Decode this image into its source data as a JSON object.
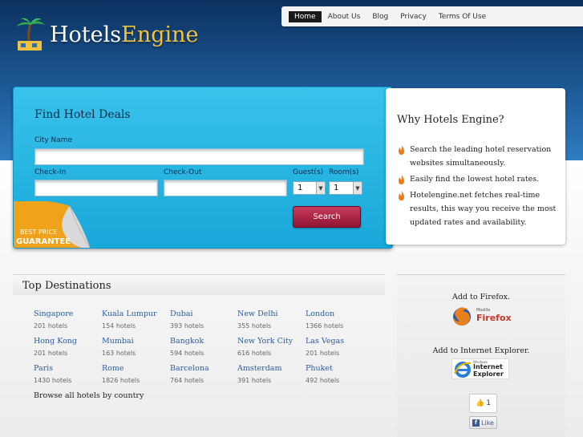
{
  "brand": {
    "hotels": "Hotels",
    "engine": "Engine"
  },
  "nav": [
    {
      "label": "Home",
      "active": true
    },
    {
      "label": "About Us"
    },
    {
      "label": "Blog"
    },
    {
      "label": "Privacy"
    },
    {
      "label": "Terms Of Use"
    }
  ],
  "search": {
    "title": "Find Hotel Deals",
    "city_label": "City Name",
    "city_value": "",
    "checkin_label": "Check-In",
    "checkin_value": "",
    "checkout_label": "Check-Out",
    "checkout_value": "",
    "guests_label": "Guest(s)",
    "guests_value": "1",
    "rooms_label": "Room(s)",
    "rooms_value": "1",
    "button": "Search",
    "badge_line1": "BEST PRICE",
    "badge_line2": "GUARANTEE"
  },
  "why": {
    "title": "Why Hotels Engine?",
    "items": [
      "Search the leading hotel reservation websites simultaneously.",
      "Easily find the lowest hotel rates.",
      "Hotelengine.net fetches real-time results, this way you receive the most updated rates and availability."
    ]
  },
  "destinations": {
    "title": "Top Destinations",
    "items": [
      {
        "city": "Singapore",
        "count": "201 hotels"
      },
      {
        "city": "Kuala Lumpur",
        "count": "154 hotels"
      },
      {
        "city": "Dubai",
        "count": "393 hotels"
      },
      {
        "city": "New Delhi",
        "count": "355 hotels"
      },
      {
        "city": "London",
        "count": "1366 hotels"
      },
      {
        "city": "Hong Kong",
        "count": "201 hotels"
      },
      {
        "city": "Mumbai",
        "count": "163 hotels"
      },
      {
        "city": "Bangkok",
        "count": "594 hotels"
      },
      {
        "city": "New York City",
        "count": "616 hotels"
      },
      {
        "city": "Las Vegas",
        "count": "201 hotels"
      },
      {
        "city": "Paris",
        "count": "1430 hotels"
      },
      {
        "city": "Rome",
        "count": "1826 hotels"
      },
      {
        "city": "Barcelona",
        "count": "764 hotels"
      },
      {
        "city": "Amsterdam",
        "count": "391 hotels"
      },
      {
        "city": "Phuket",
        "count": "492 hotels"
      }
    ],
    "browse": "Browse all hotels by country"
  },
  "side": {
    "firefox_label": "Add to Firefox.",
    "firefox_logo_small": "Mozilla",
    "firefox_logo": "Firefox",
    "ie_label": "Add to Internet Explorer.",
    "ie_logo_small": "Windows",
    "ie_logo_line1": "Internet",
    "ie_logo_line2": "Explorer",
    "like_count": "1",
    "like_label": "Like"
  },
  "colors": {
    "header_top": "#0c3160",
    "panel_blue": "#19a8da",
    "search_button": "#8e1432",
    "link_blue": "#2a5d9e",
    "logo_gold": "#f5c23c"
  }
}
